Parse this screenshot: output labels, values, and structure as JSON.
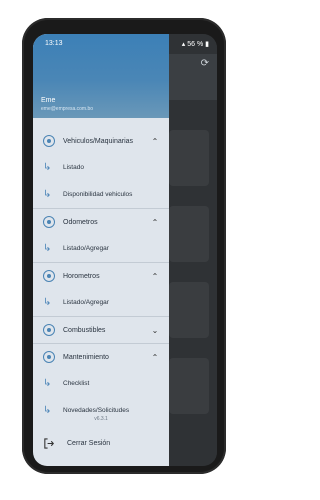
{
  "status_bar": {
    "time": "13:13",
    "battery": "56 %"
  },
  "user": {
    "name": "Eme",
    "email": "eme@empresa.com.bo"
  },
  "menu": {
    "sections": [
      {
        "label": "Vehiculos/Maquinarias",
        "chevron": "up",
        "items": [
          "Listado",
          "Disponibilidad vehiculos"
        ]
      },
      {
        "label": "Odometros",
        "chevron": "up",
        "items": [
          "Listado/Agregar"
        ]
      },
      {
        "label": "Horometros",
        "chevron": "up",
        "items": [
          "Listado/Agregar"
        ]
      },
      {
        "label": "Combustibles",
        "chevron": "down",
        "items": []
      },
      {
        "label": "Mantenimiento",
        "chevron": "up",
        "items": [
          "Checklist",
          "Novedades/Solicitudes"
        ]
      }
    ]
  },
  "version": "v6.3.1",
  "logout_label": "Cerrar Sesión",
  "colors": {
    "accent": "#4a84b4",
    "drawer_bg": "#dfe5ec",
    "header_top": "#3c80b7"
  },
  "icons": {
    "refresh": "refresh-icon",
    "section": "circle-dot-icon",
    "sub": "subdirectory-arrow-icon",
    "logout": "logout-icon"
  }
}
